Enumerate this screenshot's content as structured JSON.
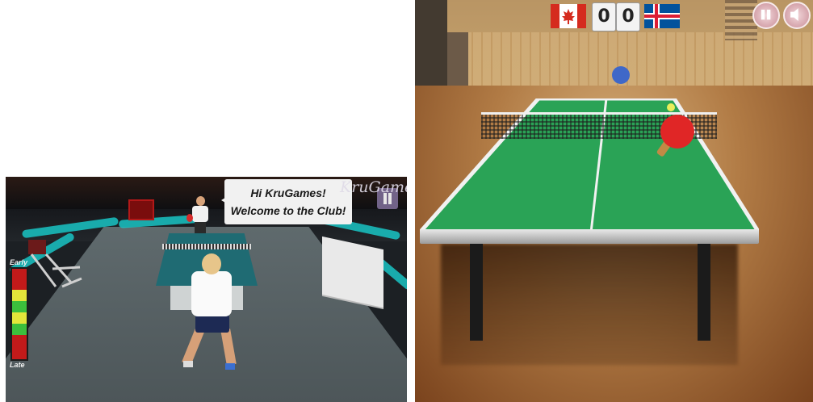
{
  "left_screen": {
    "speech_bubble": {
      "line1": "Hi KruGames!",
      "line2": "Welcome to the Club!"
    },
    "watermark": "KruGames",
    "timing_meter": {
      "top_label": "Early",
      "bottom_label": "Late",
      "segments": [
        "red",
        "yellow",
        "green",
        "yellow",
        "green",
        "red"
      ]
    },
    "icons": {
      "pause": "pause-icon"
    }
  },
  "right_screen": {
    "scoreboard": {
      "left_flag": "canada-flag",
      "right_flag": "iceland-flag",
      "left_score": "0",
      "right_score": "0"
    },
    "icons": {
      "pause": "pause-icon",
      "sound": "speaker-icon"
    }
  },
  "colors": {
    "table_green": "#2aa356",
    "meter_red": "#c21a1a",
    "meter_yellow": "#e3e63a",
    "meter_green": "#3cbf3c",
    "accent_teal": "#19c4c4"
  }
}
